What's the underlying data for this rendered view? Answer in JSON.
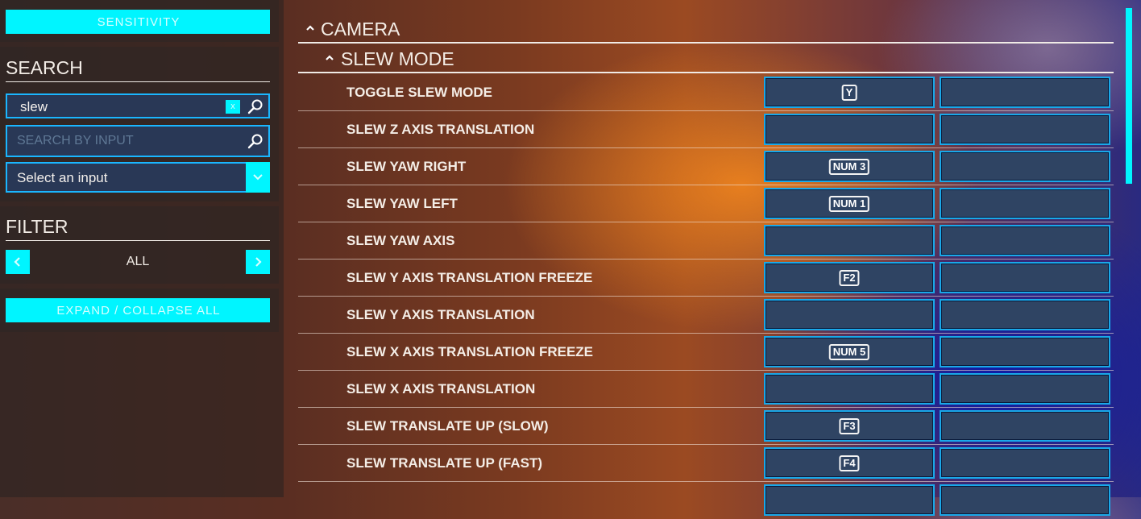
{
  "sidebar": {
    "sensitivity_label": "SENSITIVITY",
    "search": {
      "title": "SEARCH",
      "query_value": "slew",
      "clear_label": "x",
      "input_placeholder": "SEARCH BY INPUT",
      "select_value": "Select an input"
    },
    "filter": {
      "title": "FILTER",
      "value": "ALL",
      "prev_icon": "chevron-left-icon",
      "next_icon": "chevron-right-icon"
    },
    "expand_collapse_label": "EXPAND / COLLAPSE ALL"
  },
  "main": {
    "category": "CAMERA",
    "subcategory": "SLEW MODE",
    "rows": [
      {
        "name": "TOGGLE SLEW MODE",
        "primary": "Y",
        "secondary": ""
      },
      {
        "name": "SLEW Z AXIS TRANSLATION",
        "primary": "",
        "secondary": ""
      },
      {
        "name": "SLEW YAW RIGHT",
        "primary": "NUM 3",
        "secondary": ""
      },
      {
        "name": "SLEW YAW LEFT",
        "primary": "NUM 1",
        "secondary": ""
      },
      {
        "name": "SLEW YAW AXIS",
        "primary": "",
        "secondary": ""
      },
      {
        "name": "SLEW Y AXIS TRANSLATION FREEZE",
        "primary": "F2",
        "secondary": ""
      },
      {
        "name": "SLEW Y AXIS TRANSLATION",
        "primary": "",
        "secondary": ""
      },
      {
        "name": "SLEW X AXIS TRANSLATION FREEZE",
        "primary": "NUM 5",
        "secondary": ""
      },
      {
        "name": "SLEW X AXIS TRANSLATION",
        "primary": "",
        "secondary": ""
      },
      {
        "name": "SLEW TRANSLATE UP (SLOW)",
        "primary": "F3",
        "secondary": ""
      },
      {
        "name": "SLEW TRANSLATE UP (FAST)",
        "primary": "F4",
        "secondary": ""
      }
    ]
  },
  "colors": {
    "accent": "#00f5ff",
    "field_border": "#1ab6ff",
    "slot_bg": "#2f4463"
  }
}
